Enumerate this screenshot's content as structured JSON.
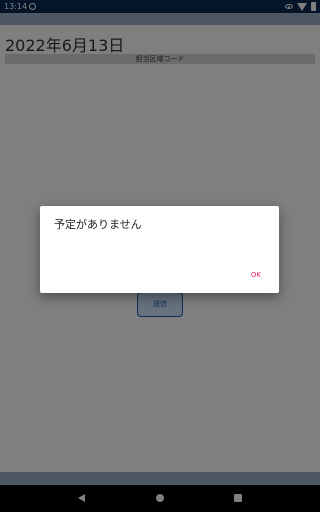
{
  "status_bar": {
    "time": "13:14"
  },
  "main": {
    "date": "2022年6月13日",
    "area_code_label": "担当区域コード",
    "send_button_label": "送信"
  },
  "dialog": {
    "message": "予定がありません",
    "ok_label": "OK",
    "ok_color": "#e91e63"
  },
  "colors": {
    "status_bar_bg": "#082a52",
    "app_bar_bg": "#9ab0c9",
    "button_border": "#1b5fb3"
  }
}
